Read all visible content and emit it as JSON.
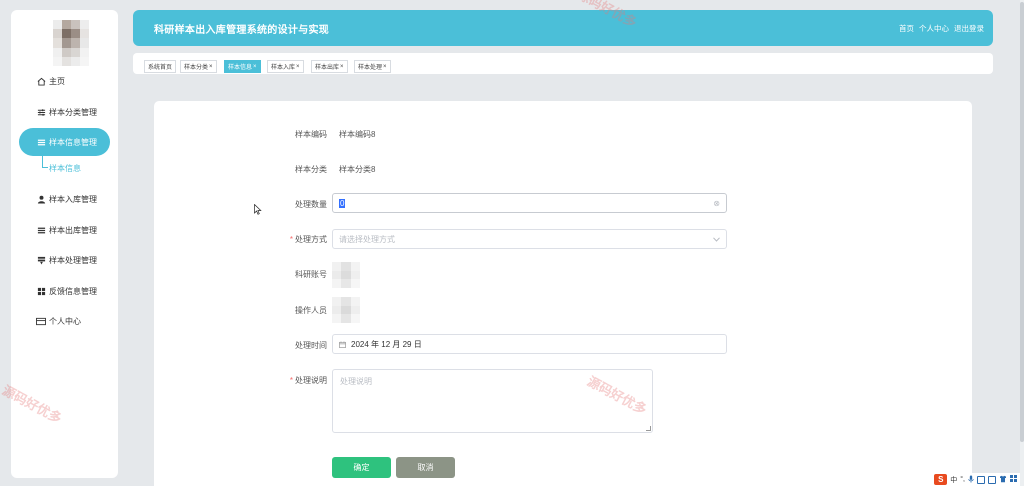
{
  "header": {
    "title": "科研样本出入库管理系统的设计与实现",
    "links": [
      "首页",
      "个人中心",
      "退出登录"
    ]
  },
  "sidebar": {
    "items": [
      {
        "label": "主页",
        "icon": "home-icon"
      },
      {
        "label": "样本分类管理",
        "icon": "sliders-icon"
      },
      {
        "label": "样本信息管理",
        "icon": "list-icon"
      },
      {
        "label": "样本入库管理",
        "icon": "user-icon"
      },
      {
        "label": "样本出库管理",
        "icon": "list-icon"
      },
      {
        "label": "样本处理管理",
        "icon": "funnel-icon"
      },
      {
        "label": "反馈信息管理",
        "icon": "grid-icon"
      },
      {
        "label": "个人中心",
        "icon": "card-icon"
      }
    ],
    "sub_item": "样本信息"
  },
  "tabs": [
    {
      "label": "系统首页",
      "closable": false
    },
    {
      "label": "样本分类",
      "closable": true
    },
    {
      "label": "样本信息",
      "closable": true,
      "active": true
    },
    {
      "label": "样本入库",
      "closable": true
    },
    {
      "label": "样本出库",
      "closable": true
    },
    {
      "label": "样本处理",
      "closable": true
    }
  ],
  "form": {
    "code_label": "样本编码",
    "code_value": "样本编码8",
    "category_label": "样本分类",
    "category_value": "样本分类8",
    "quantity_label": "处理数量",
    "quantity_value": "0",
    "method_label": "处理方式",
    "method_placeholder": "请选择处理方式",
    "account_label": "科研账号",
    "operator_label": "操作人员",
    "time_label": "处理时间",
    "time_value": "2024 年 12 月 29 日",
    "desc_label": "处理说明",
    "desc_placeholder": "处理说明",
    "confirm_label": "确定",
    "cancel_label": "取消"
  },
  "watermark": "源码好优多",
  "tray": {
    "ime": "中",
    "ime_logo": "S"
  },
  "colors": {
    "accent": "#4bbfd8",
    "confirm": "#2ec27e",
    "cancel": "#8c9486",
    "required": "#f56c6c"
  }
}
